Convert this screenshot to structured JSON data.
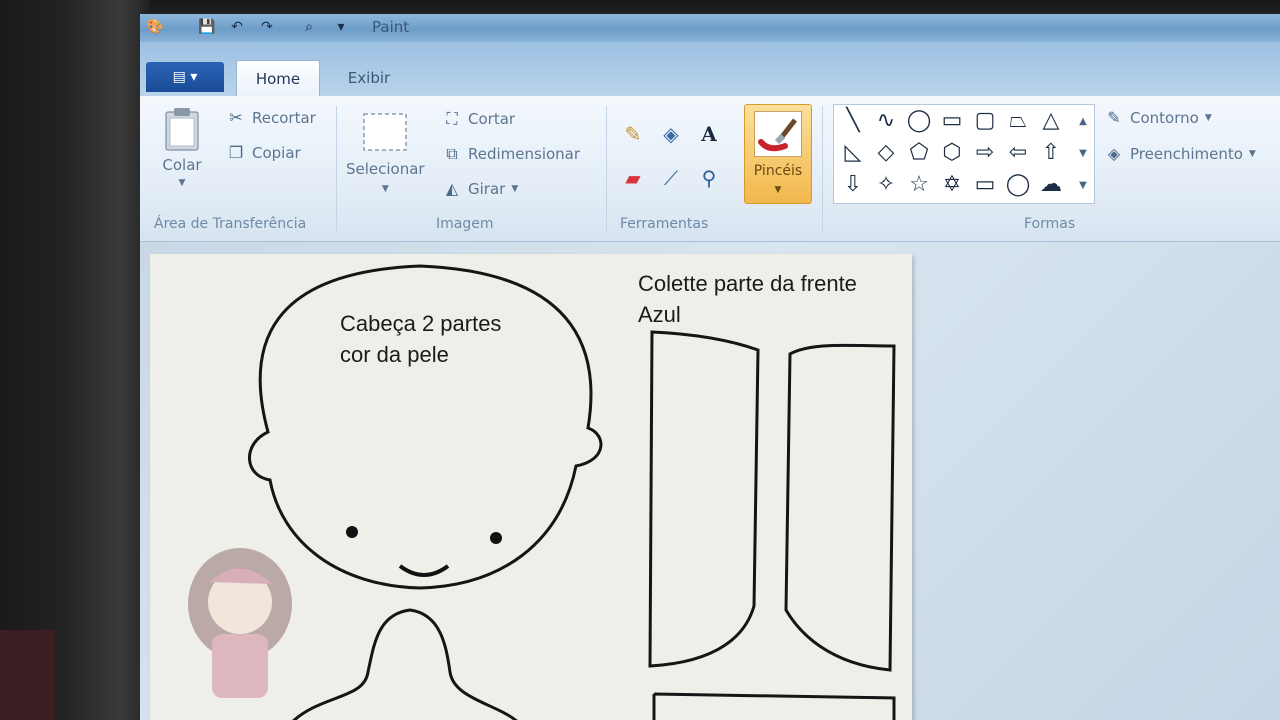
{
  "window": {
    "title": "Paint"
  },
  "tabs": [
    {
      "label": "Home"
    },
    {
      "label": "Exibir"
    }
  ],
  "clipboard": {
    "paste_label": "Colar",
    "cut_label": "Recortar",
    "copy_label": "Copiar",
    "group_label": "Área de Transferência"
  },
  "image": {
    "select_label": "Selecionar",
    "crop_label": "Cortar",
    "resize_label": "Redimensionar",
    "rotate_label": "Girar",
    "group_label": "Imagem"
  },
  "tools": {
    "group_label": "Ferramentas",
    "items": [
      "pencil-icon",
      "fill-bucket-icon",
      "text-icon",
      "eraser-icon",
      "color-picker-icon",
      "magnifier-icon"
    ]
  },
  "brushes": {
    "label": "Pincéis"
  },
  "shapes": {
    "group_label": "Formas",
    "outline_label": "Contorno",
    "fill_label": "Preenchimento"
  },
  "canvas": {
    "head_label_line1": "Cabeça 2 partes",
    "head_label_line2": "cor da pele",
    "collar_label_line1": "Colette parte da frente",
    "collar_label_line2": "Azul"
  },
  "colors": {
    "accent": "#f2b84d",
    "ribbon": "#e2ecf6",
    "app_menu": "#1a4c98"
  }
}
